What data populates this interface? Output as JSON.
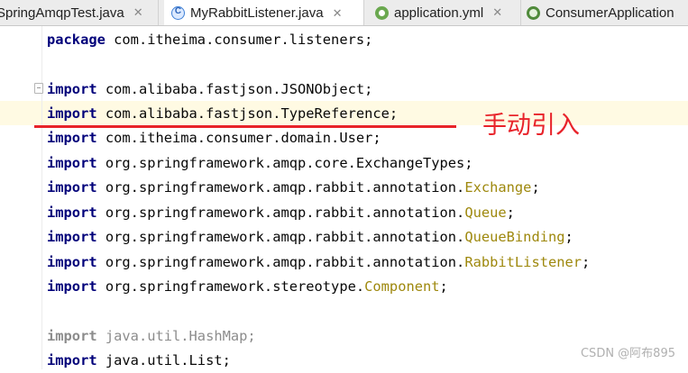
{
  "tabs": [
    {
      "label": "SpringAmqpTest.java",
      "icon": "java-class-icon"
    },
    {
      "label": "MyRabbitListener.java",
      "icon": "java-class-icon",
      "active": true
    },
    {
      "label": "application.yml",
      "icon": "yml-file-icon"
    },
    {
      "label": "ConsumerApplication",
      "icon": "spring-app-icon"
    }
  ],
  "close_symbol": "✕",
  "code": {
    "package": {
      "kw": "package",
      "text": " com.itheima.consumer.listeners;"
    },
    "imports": [
      {
        "kw": "import",
        "pre": " com.alibaba.fastjson.JSONObject;",
        "ann": "",
        "post": ""
      },
      {
        "kw": "import",
        "pre": " com.alibaba.fastjson.TypeReference;",
        "ann": "",
        "post": ""
      },
      {
        "kw": "import",
        "pre": " com.itheima.consumer.domain.User;",
        "ann": "",
        "post": ""
      },
      {
        "kw": "import",
        "pre": " org.springframework.amqp.core.ExchangeTypes;",
        "ann": "",
        "post": ""
      },
      {
        "kw": "import",
        "pre": " org.springframework.amqp.rabbit.annotation.",
        "ann": "Exchange",
        "post": ";"
      },
      {
        "kw": "import",
        "pre": " org.springframework.amqp.rabbit.annotation.",
        "ann": "Queue",
        "post": ";"
      },
      {
        "kw": "import",
        "pre": " org.springframework.amqp.rabbit.annotation.",
        "ann": "QueueBinding",
        "post": ";"
      },
      {
        "kw": "import",
        "pre": " org.springframework.amqp.rabbit.annotation.",
        "ann": "RabbitListener",
        "post": ";"
      },
      {
        "kw": "import",
        "pre": " org.springframework.stereotype.",
        "ann": "Component",
        "post": ";"
      }
    ],
    "unused_import": {
      "kw": "import",
      "text": " java.util.HashMap;"
    },
    "last_import": {
      "kw": "import",
      "text": " java.util.List;"
    }
  },
  "annotation_note": "手动引入",
  "watermark": "CSDN @阿布895",
  "colors": {
    "keyword": "#00007a",
    "annotation": "#9e880d",
    "unused": "#8c8c8c",
    "markup_red": "#e8232a",
    "highlight_row": "#fffae3"
  }
}
